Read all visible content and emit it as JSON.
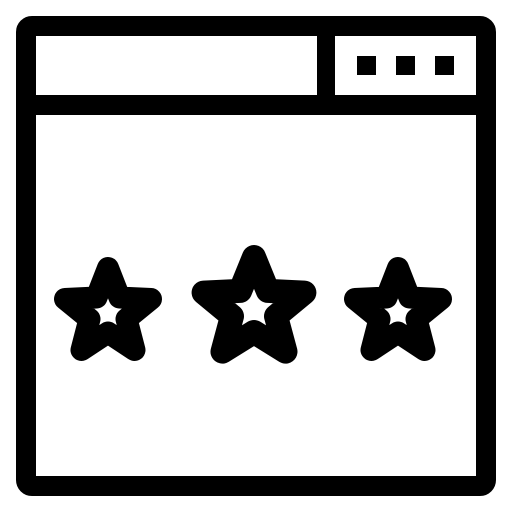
{
  "icon": {
    "name": "browser-window-rating-icon",
    "stroke_color": "#000000",
    "fill_color": "#ffffff"
  },
  "title_bar": {
    "window_control_dots": 3,
    "dot_icon_name": "menu-dot-icon"
  },
  "rating": {
    "stars_shown": 3,
    "star_style": "outlined",
    "star_icon_name": "star-icon"
  }
}
